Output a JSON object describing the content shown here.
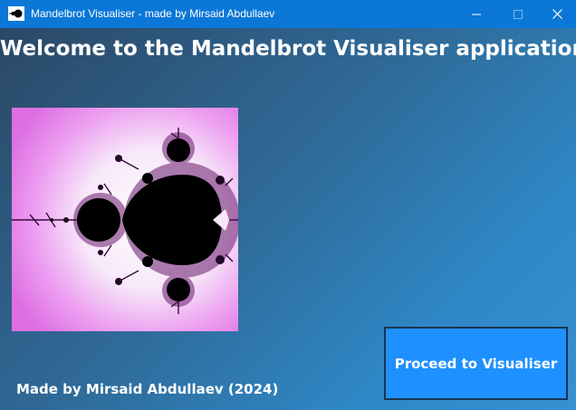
{
  "window": {
    "title": "Mandelbrot Visualiser - made by Mirsaid Abdullaev",
    "icon": "mandelbrot-app-icon",
    "controls": [
      "minimize-icon",
      "maximize-icon",
      "close-icon"
    ]
  },
  "main": {
    "welcome_text": "Welcome to the Mandelbrot Visualiser application!",
    "image": "mandelbrot-set-image",
    "credit_text": "Made by Mirsaid Abdullaev (2024)",
    "proceed_label": "Proceed to Visualiser"
  },
  "colors": {
    "titlebar": "#0b78d7",
    "button_bg": "#1e90ff",
    "text": "#ffffff"
  }
}
